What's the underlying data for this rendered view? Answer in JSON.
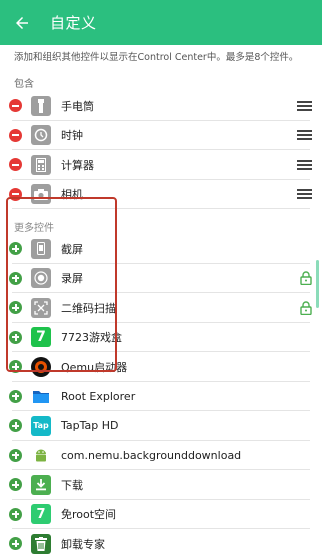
{
  "header": {
    "title": "自定义"
  },
  "description": "添加和组织其他控件以显示在Control Center中。最多是8个控件。",
  "included_section": {
    "title": "包含",
    "items": [
      {
        "label": "手电筒",
        "icon": "flashlight-icon"
      },
      {
        "label": "时钟",
        "icon": "clock-icon"
      },
      {
        "label": "计算器",
        "icon": "calculator-icon"
      },
      {
        "label": "相机",
        "icon": "camera-icon"
      }
    ]
  },
  "more_section": {
    "title": "更多控件",
    "items": [
      {
        "label": "截屏",
        "icon": "screenshot-icon",
        "locked": false
      },
      {
        "label": "录屏",
        "icon": "screen-record-icon",
        "locked": true
      },
      {
        "label": "二维码扫描",
        "icon": "qr-scan-icon",
        "locked": true
      },
      {
        "label": "7723游戏盒",
        "icon": "7723-game-box-app-icon",
        "locked": false
      },
      {
        "label": "Qemu启动器",
        "icon": "qemu-launcher-app-icon",
        "locked": false
      },
      {
        "label": "Root Explorer",
        "icon": "root-explorer-app-icon",
        "locked": false
      },
      {
        "label": "TapTap HD",
        "icon": "taptap-app-icon",
        "locked": false
      },
      {
        "label": "com.nemu.backgrounddownload",
        "icon": "android-icon",
        "locked": false
      },
      {
        "label": "下载",
        "icon": "download-app-icon",
        "locked": false
      },
      {
        "label": "免root空间",
        "icon": "no-root-space-app-icon",
        "locked": false
      },
      {
        "label": "卸载专家",
        "icon": "uninstall-expert-app-icon",
        "locked": false
      }
    ]
  },
  "colors": {
    "accent": "#2bbf7f",
    "remove": "#e53935",
    "add": "#43a047",
    "lock": "#4caf50",
    "highlight": "#c0392b"
  }
}
